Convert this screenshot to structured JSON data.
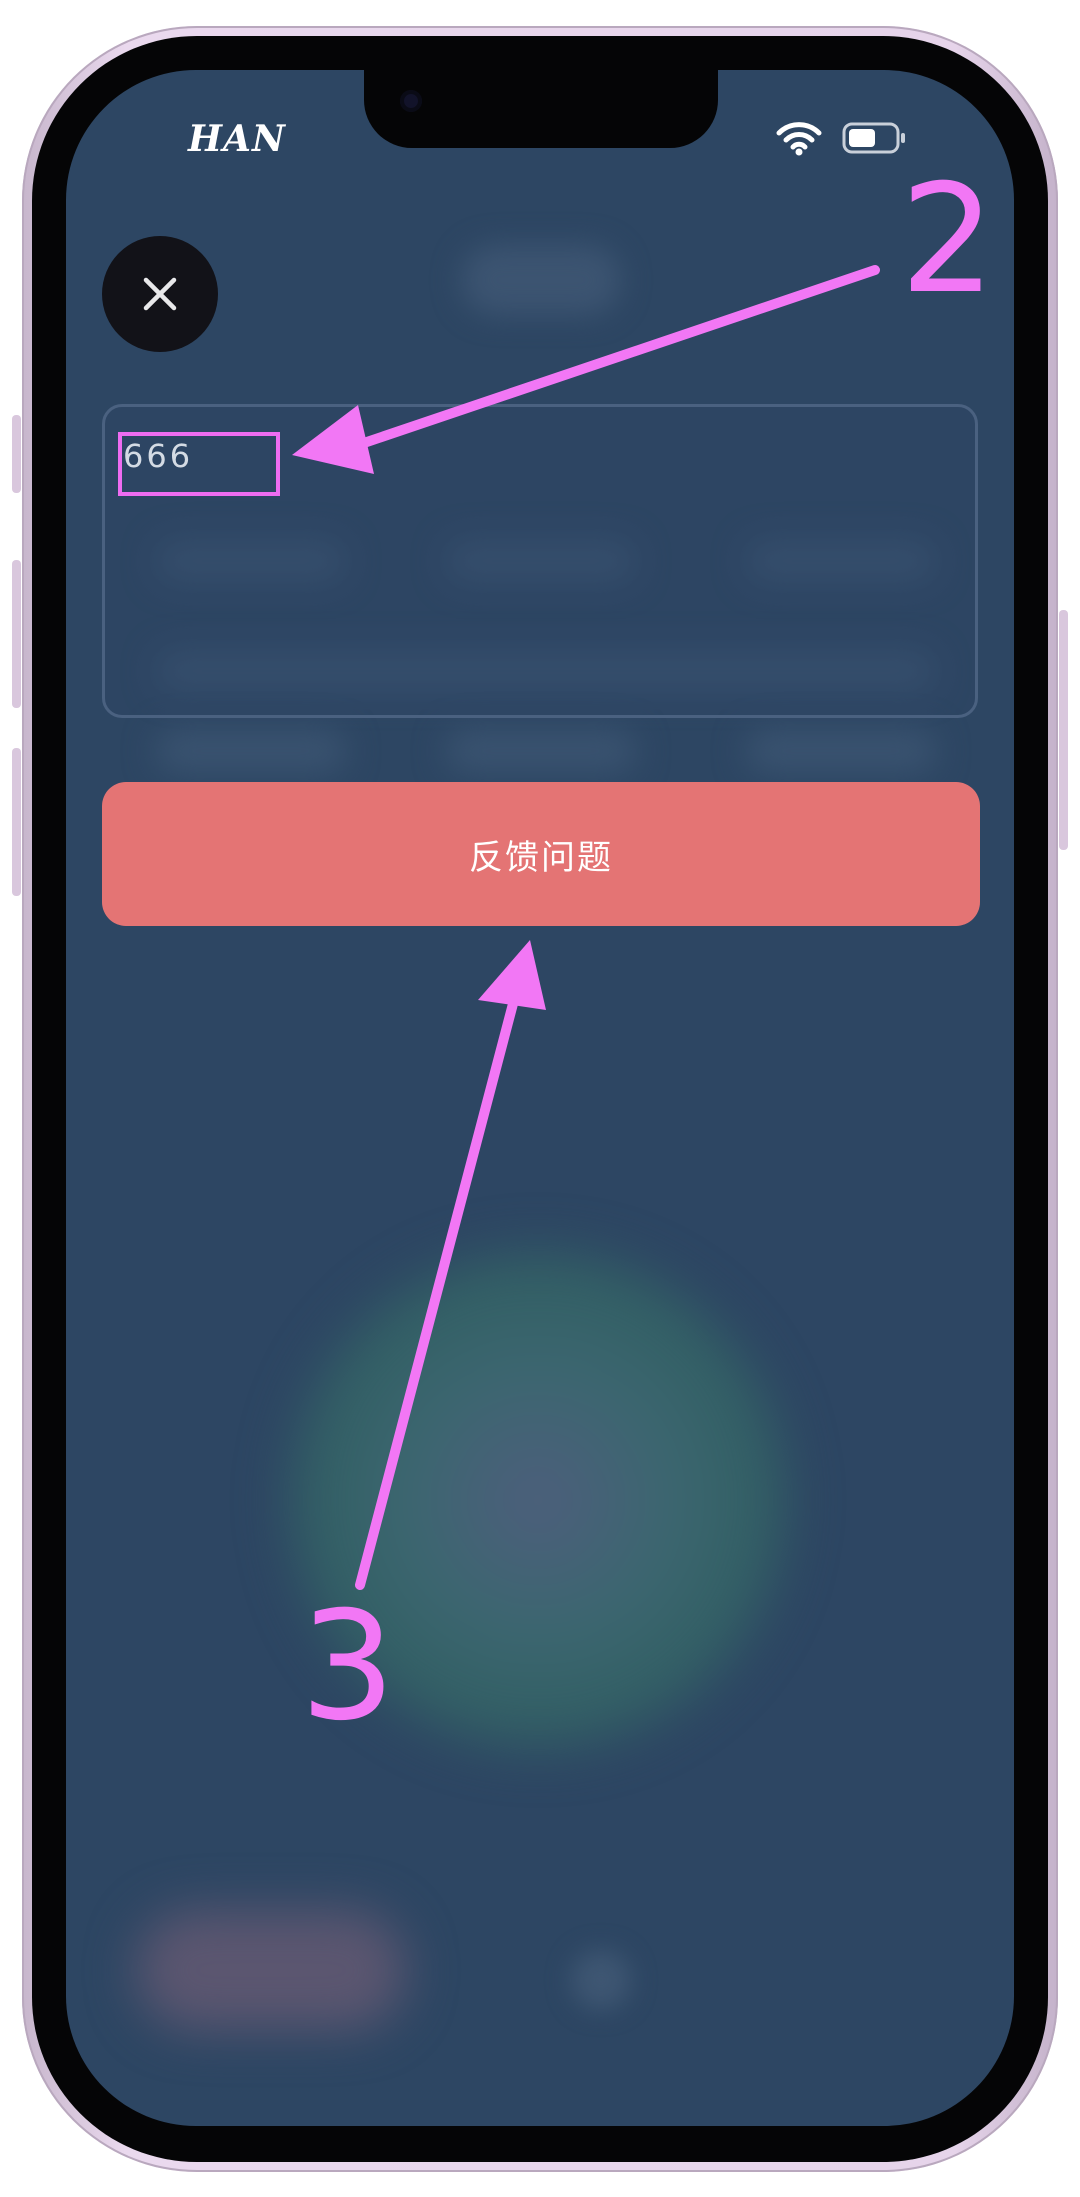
{
  "status_bar": {
    "carrier": "HAN",
    "wifi_icon": "wifi-icon",
    "battery_icon": "battery-icon"
  },
  "close_button": {
    "icon": "close-icon"
  },
  "feedback": {
    "value": "666"
  },
  "submit": {
    "label": "反馈问题"
  },
  "annotations": {
    "step_2": "2",
    "step_3": "3",
    "color": "#f277f5"
  },
  "colors": {
    "screen_bg": "#2d4663",
    "button_bg": "#e47474",
    "close_bg": "#121218"
  }
}
